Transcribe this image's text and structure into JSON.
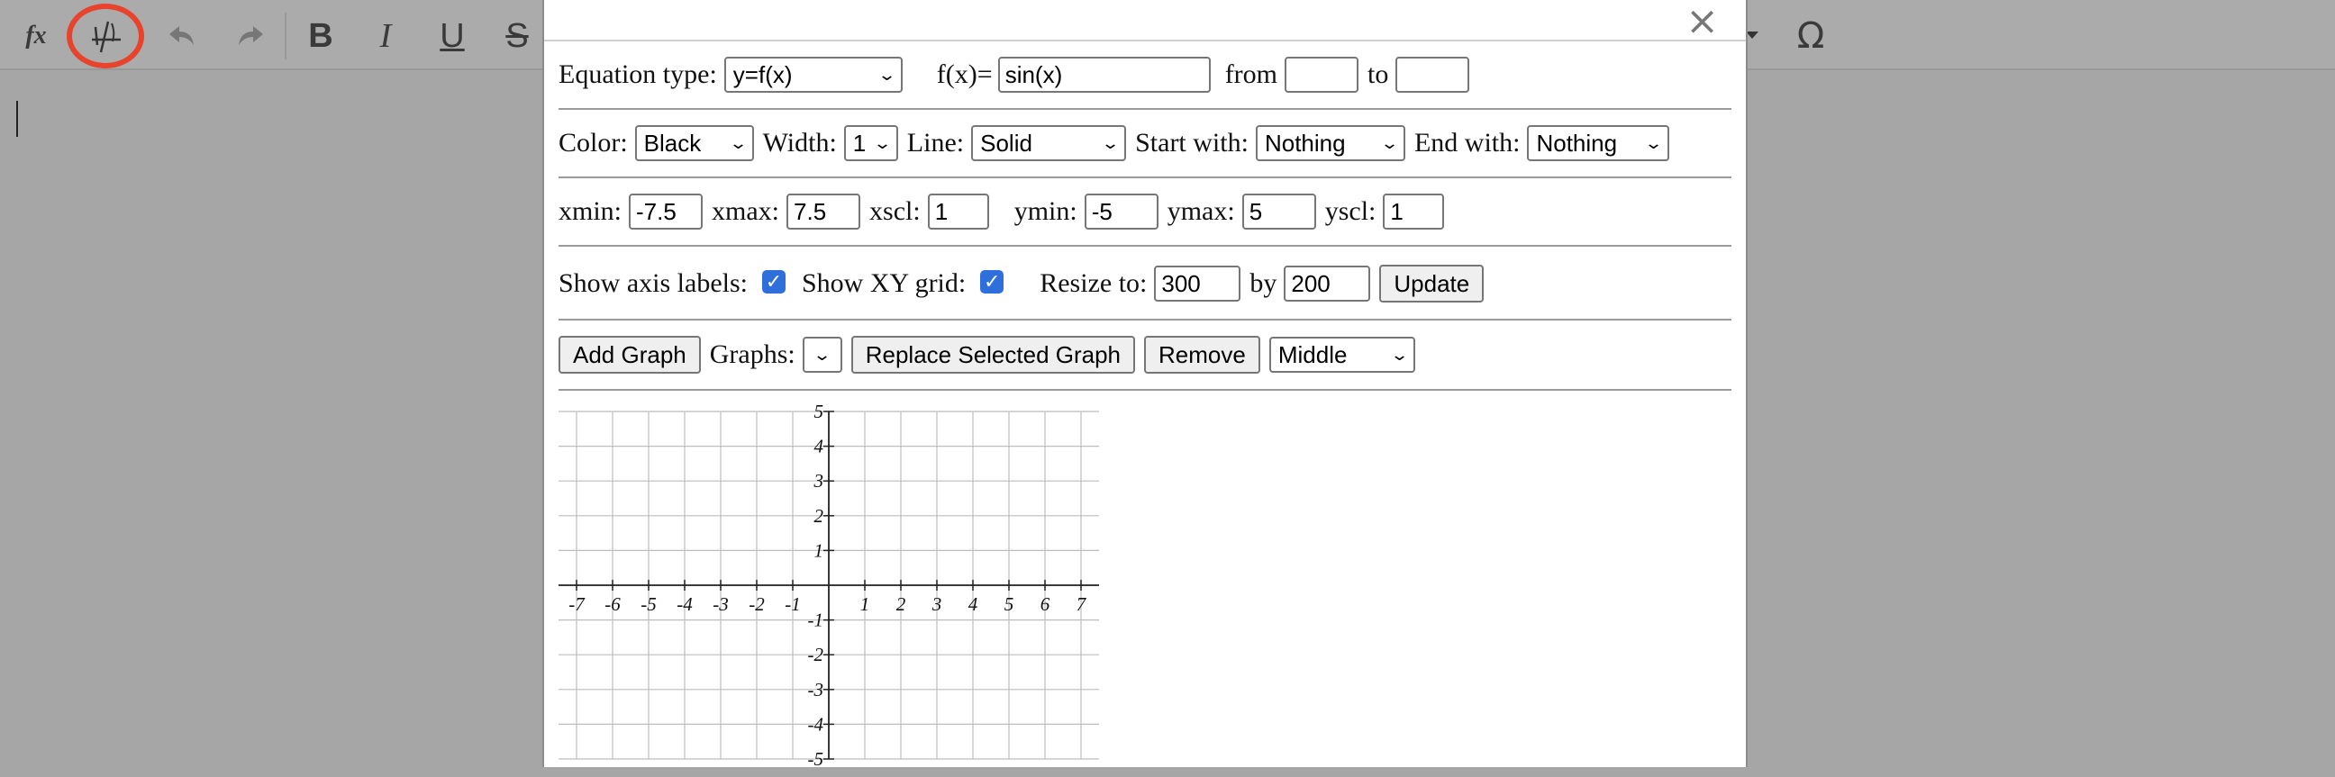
{
  "toolbar": {
    "buttons": [
      {
        "name": "formula-button",
        "icon": "fx-icon",
        "label": "fx"
      },
      {
        "name": "graph-button",
        "icon": "graph-icon"
      },
      {
        "name": "undo-button",
        "icon": "undo-arrow-icon"
      },
      {
        "name": "redo-button",
        "icon": "redo-arrow-icon"
      },
      {
        "name": "bold-button",
        "icon": "bold-icon",
        "label": "B"
      },
      {
        "name": "italic-button",
        "icon": "italic-icon",
        "label": "I"
      },
      {
        "name": "underline-button",
        "icon": "underline-icon",
        "label": "U"
      },
      {
        "name": "strikethrough-button",
        "icon": "strikethrough-icon",
        "label": "S"
      },
      {
        "name": "special-characters-button",
        "icon": "omega-icon",
        "label": "Ω"
      }
    ],
    "highlight_color": "#e8432d"
  },
  "dialog": {
    "close_symbol": "×",
    "row1": {
      "equation_type_label": "Equation type:",
      "equation_type_value": "y=f(x)",
      "fx_label": "f(x)=",
      "fx_value": "sin(x)",
      "from_label": "from",
      "from_value": "",
      "to_label": "to",
      "to_value": ""
    },
    "row2": {
      "color_label": "Color:",
      "color_value": "Black",
      "width_label": "Width:",
      "width_value": "1",
      "line_label": "Line:",
      "line_value": "Solid",
      "start_label": "Start with:",
      "start_value": "Nothing",
      "end_label": "End with:",
      "end_value": "Nothing"
    },
    "row3": {
      "xmin_label": "xmin:",
      "xmin_value": "-7.5",
      "xmax_label": "xmax:",
      "xmax_value": "7.5",
      "xscl_label": "xscl:",
      "xscl_value": "1",
      "ymin_label": "ymin:",
      "ymin_value": "-5",
      "ymax_label": "ymax:",
      "ymax_value": "5",
      "yscl_label": "yscl:",
      "yscl_value": "1"
    },
    "row4": {
      "axis_labels_label": "Show axis labels:",
      "axis_labels_checked": true,
      "xy_grid_label": "Show XY grid:",
      "xy_grid_checked": true,
      "resize_label": "Resize to:",
      "resize_w": "300",
      "by_label": "by",
      "resize_h": "200",
      "update_label": "Update"
    },
    "row5": {
      "add_graph_label": "Add Graph",
      "graphs_label": "Graphs:",
      "graphs_value": "",
      "replace_label": "Replace Selected Graph",
      "remove_label": "Remove",
      "align_value": "Middle"
    },
    "graph": {
      "x_range": [
        -7.5,
        7.5
      ],
      "y_range": [
        -5,
        5
      ],
      "x_ticks": [
        "-7",
        "-6",
        "-5",
        "-4",
        "-3",
        "-2",
        "-1",
        "1",
        "2",
        "3",
        "4",
        "5",
        "6",
        "7"
      ],
      "y_ticks": [
        "5",
        "4",
        "3",
        "2",
        "1",
        "-1",
        "-2",
        "-3",
        "-4",
        "-5"
      ]
    }
  }
}
